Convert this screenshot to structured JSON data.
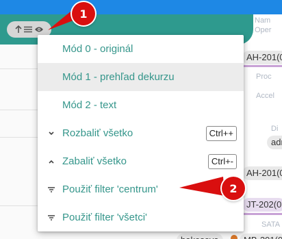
{
  "toolbar": {
    "pill_icons": [
      "arrow-up-icon",
      "list-lines-icon",
      "eye-icon"
    ]
  },
  "menu": {
    "items": [
      {
        "label": "Mód 0 - originál",
        "icon": "",
        "shortcut": ""
      },
      {
        "label": "Mód 1 - prehľad dekurzu",
        "icon": "",
        "shortcut": ""
      },
      {
        "label": "Mód 2 - text",
        "icon": "",
        "shortcut": ""
      },
      {
        "label": "Rozbaliť všetko",
        "icon": "chevron-down-icon",
        "shortcut": "Ctrl++"
      },
      {
        "label": "Zabaliť všetko",
        "icon": "chevron-up-icon",
        "shortcut": "Ctrl+-"
      },
      {
        "label": "Použiť filter 'centrum'",
        "icon": "filter-icon",
        "shortcut": ""
      },
      {
        "label": "Použiť filter 'všetci'",
        "icon": "filter-icon",
        "shortcut": ""
      }
    ],
    "active_index": 1
  },
  "annotations": {
    "badge_1": "1",
    "badge_2": "2",
    "color": "#d90f0f"
  },
  "background": {
    "tags": [
      "AH-201(0",
      "adr",
      "AH-201(0",
      "JT-202(0",
      "bakesova",
      "MB-201(0"
    ],
    "faint_texts": [
      "Nam",
      "Oper",
      "Proc",
      "Accel",
      "Di",
      "SATA"
    ]
  },
  "colors": {
    "accent": "#35968b",
    "header_green": "#2e9a8e",
    "top_blue": "#1e88e5"
  }
}
